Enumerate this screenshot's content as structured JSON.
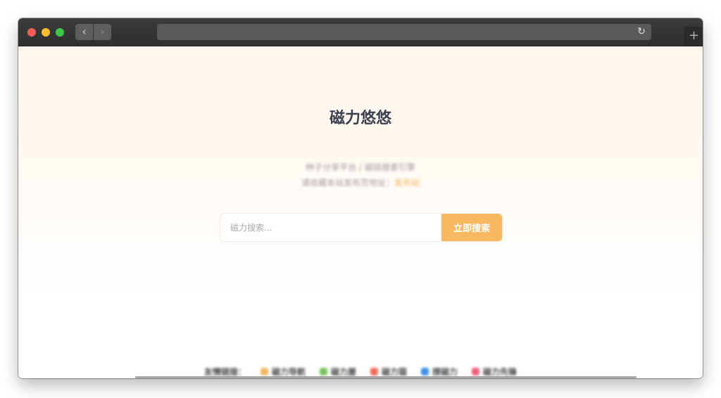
{
  "browser": {
    "back_icon": "chevron-left-icon",
    "back_glyph": "‹",
    "forward_icon": "chevron-right-icon",
    "forward_glyph": "›",
    "reload_icon": "reload-icon",
    "reload_glyph": "↻",
    "new_tab_icon": "plus-icon",
    "new_tab_glyph": "+",
    "address": ""
  },
  "page": {
    "title": "磁力悠悠",
    "subtitle": "种子分享平台 / 磁链搜索引擎",
    "notice_prefix": "请收藏本站发布页地址：",
    "notice_link": "发布站",
    "search": {
      "placeholder": "磁力搜索...",
      "button_label": "立即搜索",
      "value": ""
    },
    "friend_links": {
      "label": "友情链接：",
      "items": [
        {
          "label": "磁力导航",
          "color": "#f4b761",
          "icon": "home-icon"
        },
        {
          "label": "磁力屋",
          "color": "#7cc35e",
          "icon": "leaf-icon"
        },
        {
          "label": "磁力猫",
          "color": "#f06b5e",
          "icon": "cat-icon"
        },
        {
          "label": "搜磁力",
          "color": "#3f8fe8",
          "icon": "search-icon"
        },
        {
          "label": "磁力先锋",
          "color": "#f05f7b",
          "icon": "rocket-icon"
        }
      ]
    }
  },
  "colors": {
    "accent": "#f8b85f",
    "title_text": "#3a3f4d",
    "muted_text": "#9e9e9e"
  }
}
